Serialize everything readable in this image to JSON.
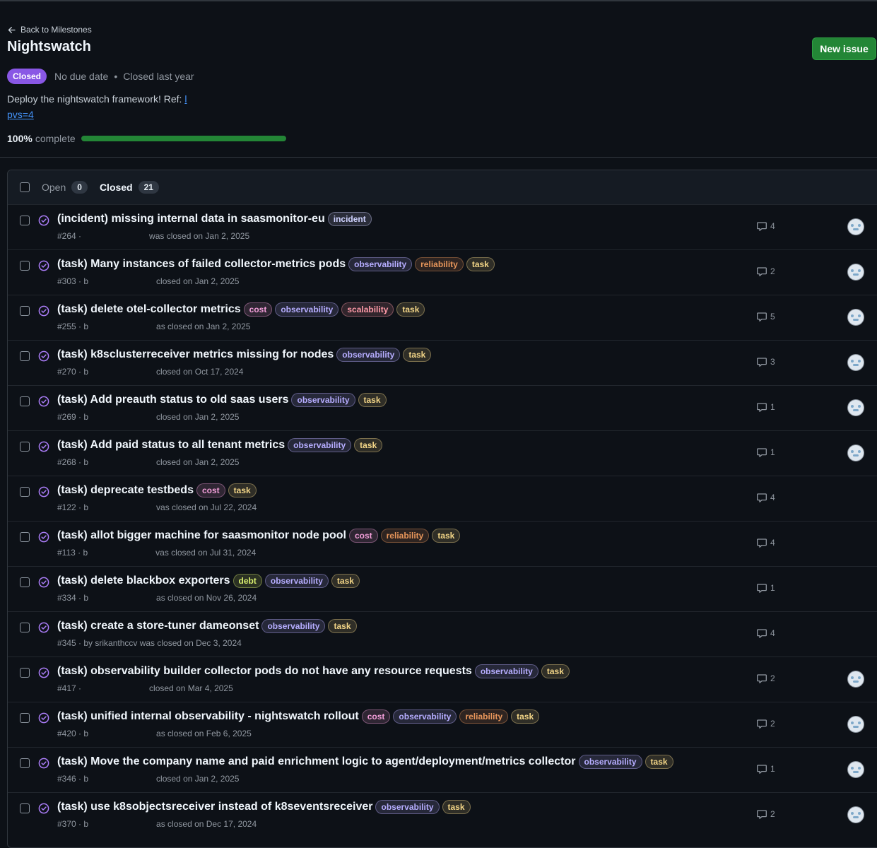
{
  "header": {
    "back_label": "Back to Milestones",
    "title": "Nightswatch",
    "new_issue_label": "New issue",
    "state_badge": "Closed",
    "due": "No due date",
    "dot": "•",
    "closed_when": "Closed last year",
    "description_text": "Deploy the nightswatch framework! Ref: ",
    "description_link_1": "l",
    "description_link_2": "pvs=4",
    "progress_percent": "100%",
    "progress_label": "complete",
    "progress_value": 1.0
  },
  "filters": {
    "open_label": "Open",
    "open_count": "0",
    "closed_label": "Closed",
    "closed_count": "21"
  },
  "colors": {
    "accent_green": "#238636",
    "closed_purple": "#8957e5"
  },
  "label_colors": {
    "incident": "#cfd3ff",
    "observability": "#b6adff",
    "reliability": "#e8965b",
    "task": "#f2d587",
    "cost": "#f29ed9",
    "scalability": "#ff9aa8",
    "debt": "#d8ee6e"
  },
  "issues": [
    {
      "title": "(incident) missing internal data in saasmonitor-eu",
      "labels": [
        "incident"
      ],
      "sub_pre": "#264 ·",
      "sub_post": "was closed on Jan 2, 2025",
      "comments": "4",
      "avatar": true
    },
    {
      "title": "(task) Many instances of failed collector-metrics pods",
      "labels": [
        "observability",
        "reliability",
        "task"
      ],
      "sub_pre": "#303 · b",
      "sub_post": "closed on Jan 2, 2025",
      "comments": "2",
      "avatar": true
    },
    {
      "title": "(task) delete otel-collector metrics",
      "labels": [
        "cost",
        "observability",
        "scalability",
        "task"
      ],
      "sub_pre": "#255 · b",
      "sub_post": "as closed on Jan 2, 2025",
      "comments": "5",
      "avatar": true
    },
    {
      "title": "(task) k8sclusterreceiver metrics missing for nodes",
      "labels": [
        "observability",
        "task"
      ],
      "sub_pre": "#270 · b",
      "sub_post": "closed on Oct 17, 2024",
      "comments": "3",
      "avatar": true
    },
    {
      "title": "(task) Add preauth status to old saas users",
      "labels": [
        "observability",
        "task"
      ],
      "sub_pre": "#269 · b",
      "sub_post": "closed on Jan 2, 2025",
      "comments": "1",
      "avatar": true
    },
    {
      "title": "(task) Add paid status to all tenant metrics",
      "labels": [
        "observability",
        "task"
      ],
      "sub_pre": "#268 · b",
      "sub_post": "closed on Jan 2, 2025",
      "comments": "1",
      "avatar": true
    },
    {
      "title": "(task) deprecate testbeds",
      "labels": [
        "cost",
        "task"
      ],
      "sub_pre": "#122 · b",
      "sub_post": "vas closed on Jul 22, 2024",
      "comments": "4",
      "avatar": false
    },
    {
      "title": "(task) allot bigger machine for saasmonitor node pool",
      "labels": [
        "cost",
        "reliability",
        "task"
      ],
      "sub_pre": "#113 · b",
      "sub_post": "vas closed on Jul 31, 2024",
      "comments": "4",
      "avatar": false
    },
    {
      "title": "(task) delete blackbox exporters",
      "labels": [
        "debt",
        "observability",
        "task"
      ],
      "sub_pre": "#334 · b",
      "sub_post": "as closed on Nov 26, 2024",
      "comments": "1",
      "avatar": false
    },
    {
      "title": "(task) create a store-tuner dameonset",
      "labels": [
        "observability",
        "task"
      ],
      "sub_pre": "#345 · by srikanthccv was closed on Dec 3, 2024",
      "sub_post": "",
      "comments": "4",
      "avatar": false
    },
    {
      "title": "(task) observability builder collector pods do not have any resource requests",
      "labels": [
        "observability",
        "task"
      ],
      "sub_pre": "#417 ·",
      "sub_post": "closed on Mar 4, 2025",
      "comments": "2",
      "avatar": true
    },
    {
      "title": "(task) unified internal observability - nightswatch rollout",
      "labels": [
        "cost",
        "observability",
        "reliability",
        "task"
      ],
      "sub_pre": "#420 · b",
      "sub_post": "as closed on Feb 6, 2025",
      "comments": "2",
      "avatar": true
    },
    {
      "title": "(task) Move the company name and paid enrichment logic to agent/deployment/metrics collector",
      "labels": [
        "observability",
        "task"
      ],
      "sub_pre": "#346 · b",
      "sub_post": "closed on Jan 2, 2025",
      "comments": "1",
      "avatar": true
    },
    {
      "title": "(task) use k8sobjectsreceiver instead of k8seventsreceiver",
      "labels": [
        "observability",
        "task"
      ],
      "sub_pre": "#370 · b",
      "sub_post": "as closed on Dec 17, 2024",
      "comments": "2",
      "avatar": true
    }
  ]
}
